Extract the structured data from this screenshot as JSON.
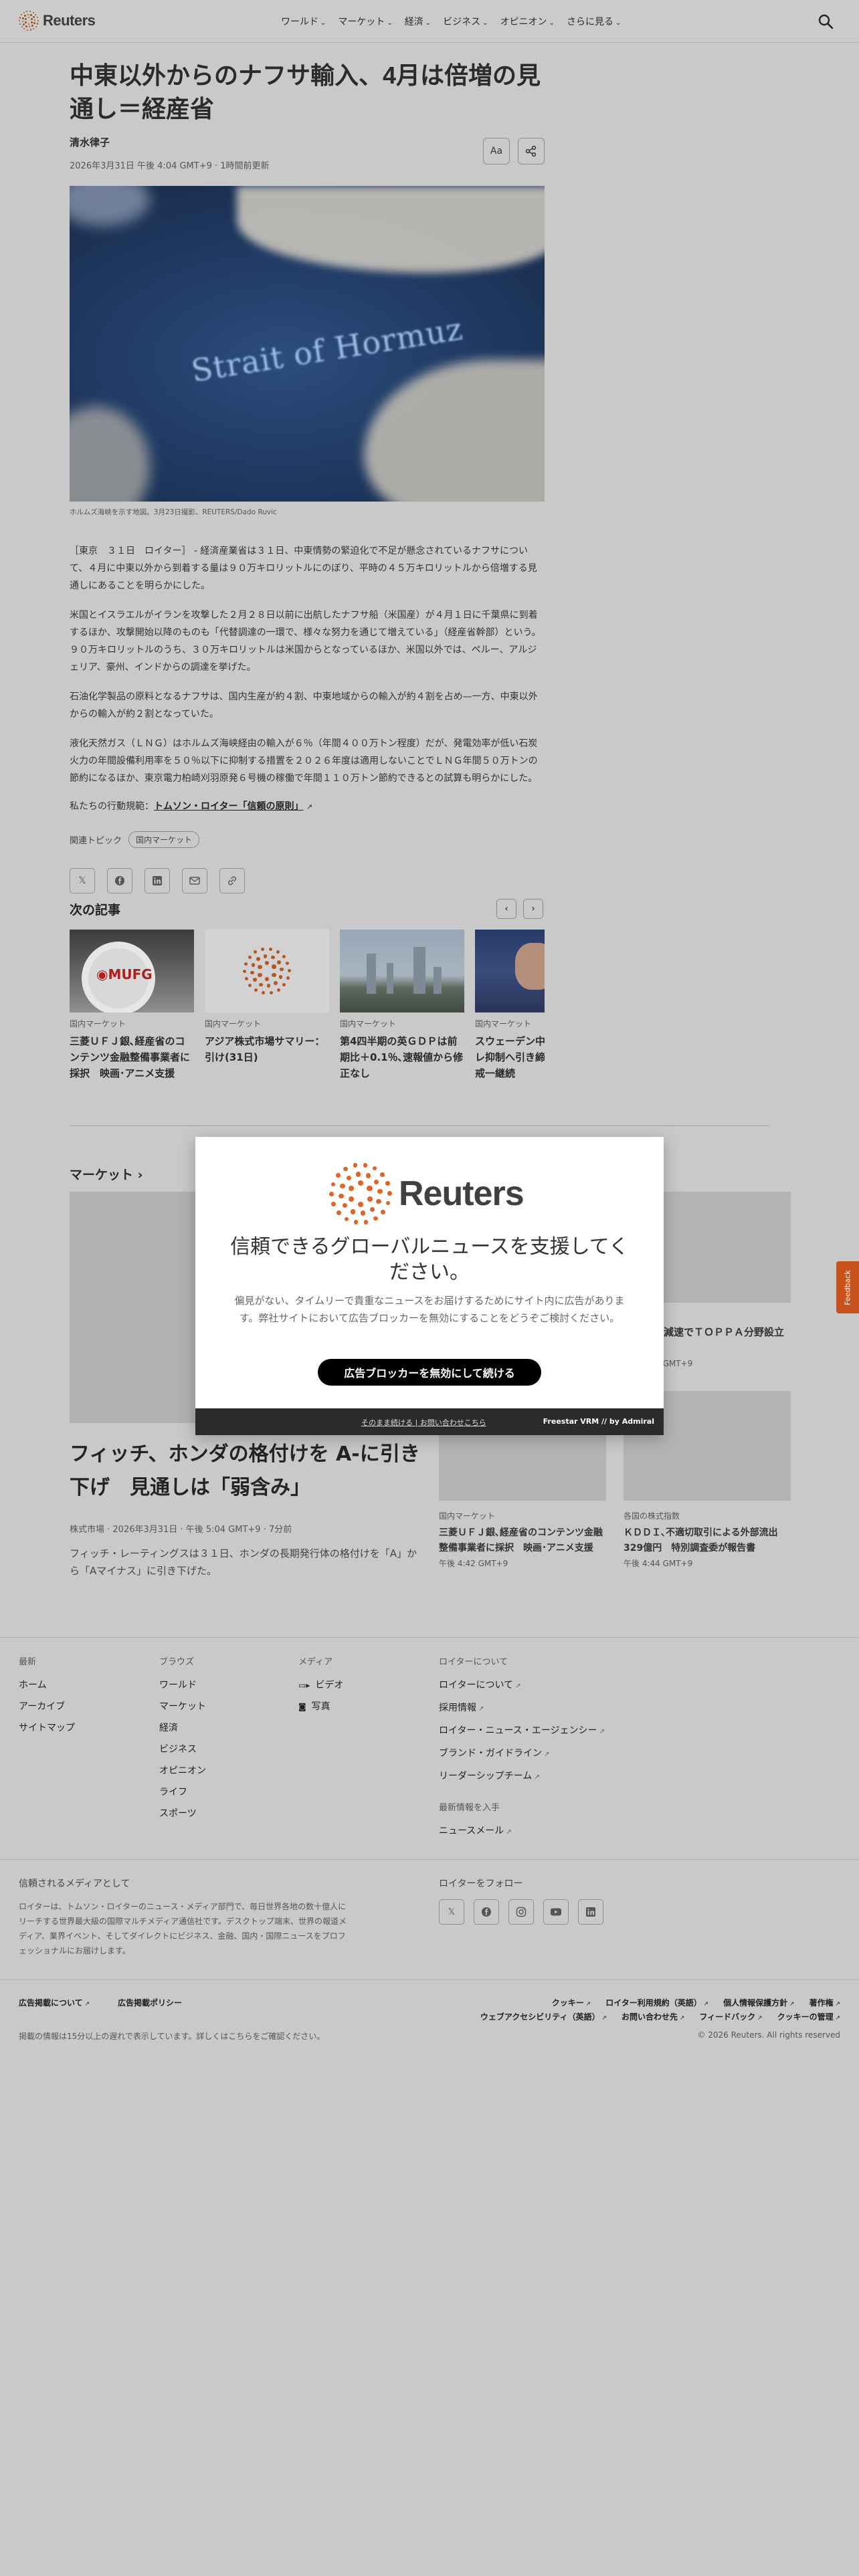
{
  "header": {
    "logo": "Reuters",
    "nav": [
      "ワールド",
      "マーケット",
      "経済",
      "ビジネス",
      "オピニオン",
      "さらに見る"
    ]
  },
  "article": {
    "title": "中東以外からのナフサ輸入、4月は倍増の見通し＝経産省",
    "author": "清水律子",
    "dateline": "2026年3月31日 午後 4:04 GMT+9 · 1時間前更新",
    "font_button": "Aa",
    "hero_map_label": "Strait of Hormuz",
    "caption": "ホルムズ海峡を示す地図。3月23日撮影。REUTERS/Dado Ruvic",
    "paragraphs": [
      "［東京　３１日　ロイター］ - 経済産業省は３１日、中東情勢の緊迫化で不足が懸念されているナフサについて、４月に中東以外から到着する量は９０万キロリットルにのぼり、平時の４５万キロリットルから倍増する見通しにあることを明らかにした。",
      "米国とイスラエルがイランを攻撃した２月２８日以前に出航したナフサ船（米国産）が４月１日に千葉県に到着するほか、攻撃開始以降のものも「代替調達の一環で、様々な努力を通じて増えている」（経産省幹部）という。９０万キロリットルのうち、３０万キロリットルは米国からとなっているほか、米国以外では、ペルー、アルジェリア、豪州、インドからの調達を挙げた。",
      "石油化学製品の原料となるナフサは、国内生産が約４割、中東地域からの輸入が約４割を占め—一方、中東以外からの輸入が約２割となっていた。",
      "液化天然ガス（ＬＮＧ）はホルムズ海峡経由の輸入が６％（年間４００万トン程度）だが、発電効率が低い石炭火力の年間設備利用率を５０％以下に抑制する措置を２０２６年度は適用しないことでＬＮＧ年間５０万トンの節約になるほか、東京電力柏崎刈羽原発６号機の稼働で年間１１０万トン節約できるとの試算も明らかにした。"
    ],
    "trust_prefix": "私たちの行動規範：",
    "trust_link": "トムソン・ロイター「信頼の原則」",
    "topics_label": "関連トピック",
    "topic_chip": "国内マーケット"
  },
  "next": {
    "title": "次の記事",
    "cards": [
      {
        "kicker": "国内マーケット",
        "title": "三菱ＵＦＪ銀､経産省のコンテンツ金融整備事業者に採択　映画･アニメ支援"
      },
      {
        "kicker": "国内マーケット",
        "title": "アジア株式市場サマリー：引け(31日)"
      },
      {
        "kicker": "国内マーケット",
        "title": "第4四半期の英ＧＤＰは前期比＋0.1％､速報値から修正なし"
      },
      {
        "kicker": "国内マーケット",
        "title": "スウェーデン中銀、インフレ抑制へ引き締め必要も 警戒一継続"
      }
    ]
  },
  "markets": {
    "title": "マーケット",
    "headline": "フィッチ、ホンダの格付けを A-に引き下げ　見通しは「弱含み」",
    "meta": "株式市場 · 2026年3月31日 · 午後 5:04 GMT+9 · 7分前",
    "summary": "フィッチ・レーティングスは３１日、ホンダの長期発行体の格付けを「A」から「Aマイナス」に引き下げた。",
    "side_title": "ち、ＥＶ減速でＴＯＰＰＡ分野設立見送り",
    "side_time": "午後 4:38 GMT+9",
    "cards": [
      {
        "kicker": "国内マーケット",
        "title": "三菱ＵＦＪ銀､経産省のコンテンツ金融整備事業者に採択　映画･アニメ支援",
        "time": "午後 4:42 GMT+9"
      },
      {
        "kicker": "各国の株式指数",
        "title": "ＫＤＤＩ､不適切取引による外部流出329億円　特別調査委が報告書",
        "time": "午後 4:44 GMT+9"
      }
    ]
  },
  "modal": {
    "logo": "Reuters",
    "heading": "信頼できるグローバルニュースを支援してください。",
    "body": "偏見がない、タイムリーで貴重なニュースをお届けするためにサイト内に広告があります。弊社サイトにおいて広告ブロッカーを無効にすることをどうぞご検討ください。",
    "button": "広告ブロッカーを無効にして続ける",
    "footer_links": "そのまま続ける | お問い合わせこちら",
    "footer_brand": "Freestar VRM  // by Admiral"
  },
  "feedback": "Feedback",
  "footer": {
    "col1": {
      "heading": "最新",
      "items": [
        "ホーム",
        "アーカイブ",
        "サイトマップ"
      ]
    },
    "col2": {
      "heading": "ブラウズ",
      "items": [
        "ワールド",
        "マーケット",
        "経済",
        "ビジネス",
        "オピニオン",
        "ライフ",
        "スポーツ"
      ]
    },
    "col3": {
      "heading": "メディア",
      "items": [
        "ビデオ",
        "写真"
      ]
    },
    "col4": {
      "heading": "ロイターについて",
      "items": [
        "ロイターについて",
        "採用情報",
        "ロイター・ニュース・エージェンシー",
        "ブランド・ガイドライン",
        "リーダーシップチーム"
      ],
      "sub_heading": "最新情報を入手",
      "sub_item": "ニュースメール"
    },
    "trust_heading": "信頼されるメディアとして",
    "trust_text": "ロイターは、トムソン・ロイターのニュース・メディア部門で、毎日世界各地の数十億人にリーチする世界最大級の国際マルチメディア通信社です。デスクトップ端末、世界の報道メディア、業界イベント、そしてダイレクトにビジネス、金融、国内・国際ニュースをプロフェッショナルにお届けします。",
    "follow_heading": "ロイターをフォロー",
    "bottom_left_1": "広告掲載について",
    "bottom_left_2": "広告掲載ポリシー",
    "bottom_links": [
      "クッキー",
      "ロイター利用規約（英語）",
      "個人情報保護方針",
      "著作権",
      "ウェブアクセシビリティ（英語）",
      "お問い合わせ先",
      "フィードバック",
      "クッキーの管理"
    ],
    "fine_print": "掲載の情報は15分以上の遅れで表示しています。詳しくはこちらをご確認ください。",
    "copyright": "© 2026 Reuters. All rights reserved"
  }
}
